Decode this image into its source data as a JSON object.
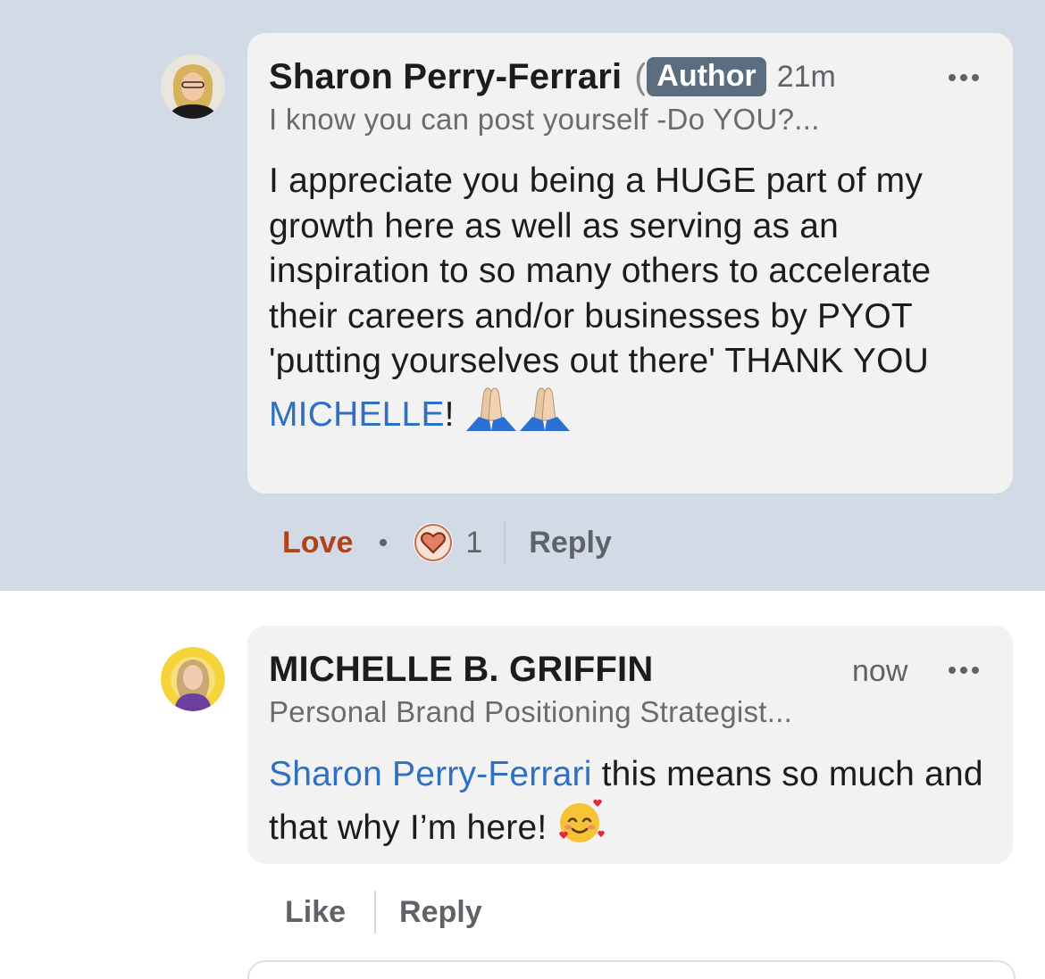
{
  "comments": [
    {
      "author": "Sharon Perry-Ferrari",
      "name_trunc": "(S",
      "badge": "Author",
      "time": "21m",
      "headline": "I know you can post yourself -Do YOU?...",
      "text_before": "I appreciate you being a HUGE part of my growth here as well as serving as an inspiration to so many others to accelerate their careers and/or businesses by PYOT  'putting yourselves out there'  THANK YOU ",
      "mention": "MICHELLE",
      "text_after": "!",
      "emoji": "folded-hands x2",
      "reaction_label": "Love",
      "reaction_count": "1",
      "reply_label": "Reply"
    },
    {
      "author": "MICHELLE B. GRIFFIN",
      "time": "now",
      "headline": "Personal Brand Positioning Strategist...",
      "mention": "Sharon Perry-Ferrari",
      "text_after": " this means so much and that why I’m here!",
      "emoji": "smiling-face-with-hearts",
      "like_label": "Like",
      "reply_label": "Reply"
    }
  ],
  "colors": {
    "highlight_bg": "#d2dbe5",
    "bubble_bg": "#f2f2f2",
    "mention": "#2f6fc4",
    "love": "#b0431c",
    "badge": "#5b6e80"
  }
}
